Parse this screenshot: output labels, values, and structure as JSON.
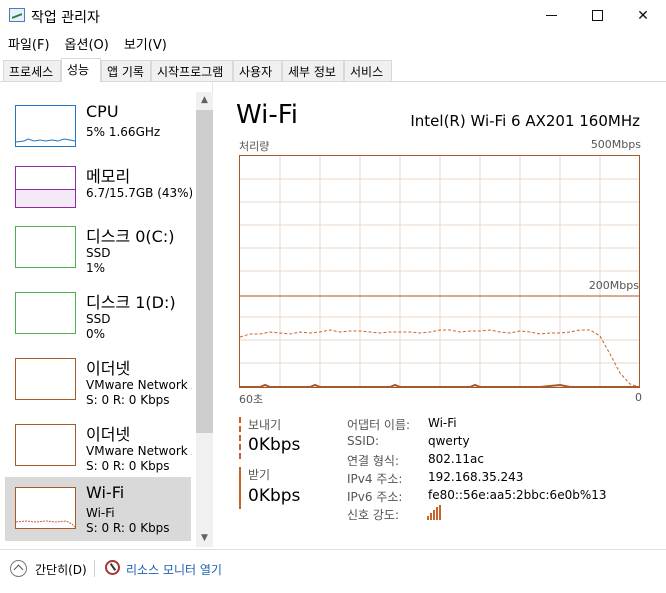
{
  "window": {
    "title": "작업 관리자"
  },
  "menu": [
    "파일(F)",
    "옵션(O)",
    "보기(V)"
  ],
  "tabs": [
    "프로세스",
    "성능",
    "앱 기록",
    "시작프로그램",
    "사용자",
    "세부 정보",
    "서비스"
  ],
  "active_tab": "성능",
  "sidebar": {
    "items": [
      {
        "name": "CPU",
        "line1": "5% 1.66GHz",
        "line2": "",
        "color": "#1f79c4"
      },
      {
        "name": "메모리",
        "line1": "6.7/15.7GB (43%)",
        "line2": "",
        "color": "#8e2aa4"
      },
      {
        "name": "디스크 0(C:)",
        "line1": "SSD",
        "line2": "1%",
        "color": "#4caf50"
      },
      {
        "name": "디스크 1(D:)",
        "line1": "SSD",
        "line2": "0%",
        "color": "#4caf50"
      },
      {
        "name": "이더넷",
        "line1": "VMware Network Ad",
        "line2": "S: 0 R: 0 Kbps",
        "color": "#a45a2a"
      },
      {
        "name": "이더넷",
        "line1": "VMware Network Ad",
        "line2": "S: 0 R: 0 Kbps",
        "color": "#a45a2a"
      },
      {
        "name": "Wi-Fi",
        "line1": "Wi-Fi",
        "line2": "S: 0 R: 0 Kbps",
        "color": "#a45a2a"
      }
    ]
  },
  "main": {
    "title": "Wi-Fi",
    "adapter": "Intel(R) Wi-Fi 6 AX201 160MHz",
    "graph_label": "처리량",
    "graph_max": "500Mbps",
    "graph_mid": "200Mbps",
    "graph_time_left": "60초",
    "graph_time_right": "0",
    "send_label": "보내기",
    "send_value": "0Kbps",
    "recv_label": "받기",
    "recv_value": "0Kbps",
    "details": [
      {
        "key": "어댑터 이름:",
        "value": "Wi-Fi"
      },
      {
        "key": "SSID:",
        "value": "qwerty"
      },
      {
        "key": "연결 형식:",
        "value": "802.11ac"
      },
      {
        "key": "IPv4 주소:",
        "value": "192.168.35.243"
      },
      {
        "key": "IPv6 주소:",
        "value": "fe80::56e:aa5:2bbc:6e0b%13"
      },
      {
        "key": "신호 강도:",
        "value": ""
      }
    ],
    "accent_color": "#c8642a"
  },
  "footer": {
    "fewer_details": "간단히(D)",
    "resource_monitor": "리소스 모니터 열기"
  }
}
